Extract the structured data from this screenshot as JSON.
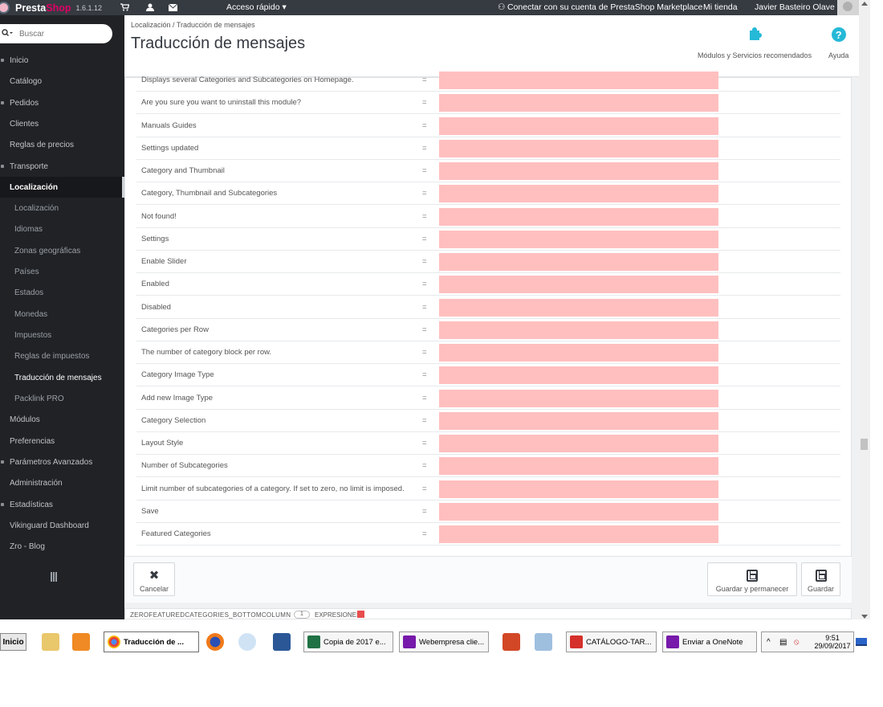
{
  "topbar": {
    "logo_left": "Presta",
    "logo_right": "Shop",
    "version": "1.6.1.12",
    "quick_access": "Acceso rápido ▾",
    "marketplace": "Conectar con su cuenta de PrestaShop Marketplace",
    "my_store": "Mi tienda",
    "user": "Javier Basteiro Olave ▾"
  },
  "sidebar": {
    "search_placeholder": "Buscar",
    "items": [
      {
        "label": "Inicio"
      },
      {
        "label": "Catálogo"
      },
      {
        "label": "Pedidos"
      },
      {
        "label": "Clientes"
      },
      {
        "label": "Reglas de precios"
      },
      {
        "label": "Transporte"
      },
      {
        "label": "Localización"
      }
    ],
    "subitems": [
      {
        "label": "Localización"
      },
      {
        "label": "Idiomas"
      },
      {
        "label": "Zonas geográficas"
      },
      {
        "label": "Países"
      },
      {
        "label": "Estados"
      },
      {
        "label": "Monedas"
      },
      {
        "label": "Impuestos"
      },
      {
        "label": "Reglas de impuestos"
      },
      {
        "label": "Traducción de mensajes"
      },
      {
        "label": "Packlink PRO"
      }
    ],
    "items_after": [
      {
        "label": "Módulos"
      },
      {
        "label": "Preferencias"
      },
      {
        "label": "Parámetros Avanzados"
      },
      {
        "label": "Administración"
      },
      {
        "label": "Estadísticas"
      },
      {
        "label": "Vikinguard Dashboard"
      },
      {
        "label": "Zro - Blog"
      }
    ]
  },
  "header": {
    "breadcrumb": "Localización  /  Traducción de mensajes",
    "title": "Traducción de mensajes",
    "modules_label": "Módulos y Servicios recomendados",
    "help_label": "Ayuda"
  },
  "translations": {
    "separator": "=",
    "rows": [
      {
        "label": "Displays several Categories and Subcategories on Homepage.",
        "value": ""
      },
      {
        "label": "Are you sure you want to uninstall this module?",
        "value": ""
      },
      {
        "label": "Manuals Guides",
        "value": ""
      },
      {
        "label": "Settings updated",
        "value": ""
      },
      {
        "label": "Category and Thumbnail",
        "value": ""
      },
      {
        "label": "Category, Thumbnail and Subcategories",
        "value": ""
      },
      {
        "label": "Not found!",
        "value": ""
      },
      {
        "label": "Settings",
        "value": ""
      },
      {
        "label": "Enable Slider",
        "value": ""
      },
      {
        "label": "Enabled",
        "value": ""
      },
      {
        "label": "Disabled",
        "value": ""
      },
      {
        "label": "Categories per Row",
        "value": ""
      },
      {
        "label": "The number of category block per row.",
        "value": ""
      },
      {
        "label": "Category Image Type",
        "value": ""
      },
      {
        "label": "Add new Image Type",
        "value": ""
      },
      {
        "label": "Category Selection",
        "value": ""
      },
      {
        "label": "Layout Style",
        "value": ""
      },
      {
        "label": "Number of Subcategories",
        "value": ""
      },
      {
        "label": "Limit number of subcategories of a category. If set to zero, no limit is imposed.",
        "value": ""
      },
      {
        "label": "Save",
        "value": ""
      },
      {
        "label": "Featured Categories",
        "value": ""
      }
    ]
  },
  "actions": {
    "cancel": "Cancelar",
    "save_stay": "Guardar y permanecer",
    "save": "Guardar"
  },
  "next_section": {
    "title": "ZEROFEATUREDCATEGORIES_BOTTOMCOLUMN",
    "count": "1",
    "expressions": "EXPRESIONES"
  },
  "taskbar": {
    "start": "Inicio",
    "tasks": [
      {
        "label": "Traducción de ..."
      },
      {
        "label": "Copia de 2017 e..."
      },
      {
        "label": "Webempresa clie..."
      },
      {
        "label": "CATÁLOGO-TAR..."
      },
      {
        "label": "Enviar a OneNote"
      }
    ],
    "time": "9:51",
    "date": "29/09/2017"
  },
  "colors": {
    "topbar": "#363a41",
    "sidebar": "#202226",
    "accent": "#25b9d7",
    "missing_translation": "#ffbfbf",
    "brand_pink": "#df0067"
  }
}
